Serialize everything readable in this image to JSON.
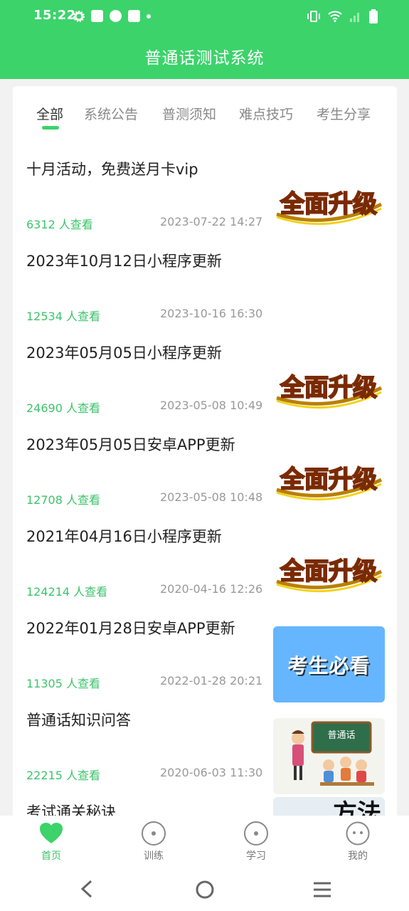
{
  "status_bar": {
    "time": "15:22"
  },
  "header": {
    "title": "普通话测试系统"
  },
  "tabs": [
    {
      "label": "全部",
      "active": true
    },
    {
      "label": "系统公告",
      "active": false
    },
    {
      "label": "普测须知",
      "active": false
    },
    {
      "label": "难点技巧",
      "active": false
    },
    {
      "label": "考生分享",
      "active": false
    }
  ],
  "articles": [
    {
      "title": "十月活动，免费送月卡vip",
      "views": "6312 人查看",
      "date": "2023-07-22 14:27",
      "thumb": "upgrade",
      "thumb_text": "全面升级"
    },
    {
      "title": "2023年10月12日小程序更新",
      "views": "12534 人查看",
      "date": "2023-10-16 16:30",
      "thumb": "none",
      "thumb_text": ""
    },
    {
      "title": "2023年05月05日小程序更新",
      "views": "24690 人查看",
      "date": "2023-05-08 10:49",
      "thumb": "upgrade",
      "thumb_text": "全面升级"
    },
    {
      "title": "2023年05月05日安卓APP更新",
      "views": "12708 人查看",
      "date": "2023-05-08 10:48",
      "thumb": "upgrade",
      "thumb_text": "全面升级"
    },
    {
      "title": "2021年04月16日小程序更新",
      "views": "124214 人查看",
      "date": "2020-04-16 12:26",
      "thumb": "upgrade",
      "thumb_text": "全面升级"
    },
    {
      "title": "2022年01月28日安卓APP更新",
      "views": "11305 人查看",
      "date": "2022-01-28 20:21",
      "thumb": "notice",
      "thumb_text": "考生必看"
    },
    {
      "title": "普通话知识问答",
      "views": "22215 人查看",
      "date": "2020-06-03 11:30",
      "thumb": "classroom",
      "thumb_text": "普通话"
    },
    {
      "title": "考试通关秘诀",
      "views": "",
      "date": "",
      "thumb": "method",
      "thumb_text": "方法"
    }
  ],
  "bottom_nav": [
    {
      "label": "首页",
      "icon": "heart-icon",
      "active": true
    },
    {
      "label": "训练",
      "icon": "circle-dot-icon",
      "active": false
    },
    {
      "label": "学习",
      "icon": "circle-dot-icon",
      "active": false
    },
    {
      "label": "我的",
      "icon": "face-icon",
      "active": false
    }
  ],
  "colors": {
    "brand_green": "#3cd36b",
    "views_green": "#3cc46a",
    "notice_blue": "#66b6ff"
  }
}
